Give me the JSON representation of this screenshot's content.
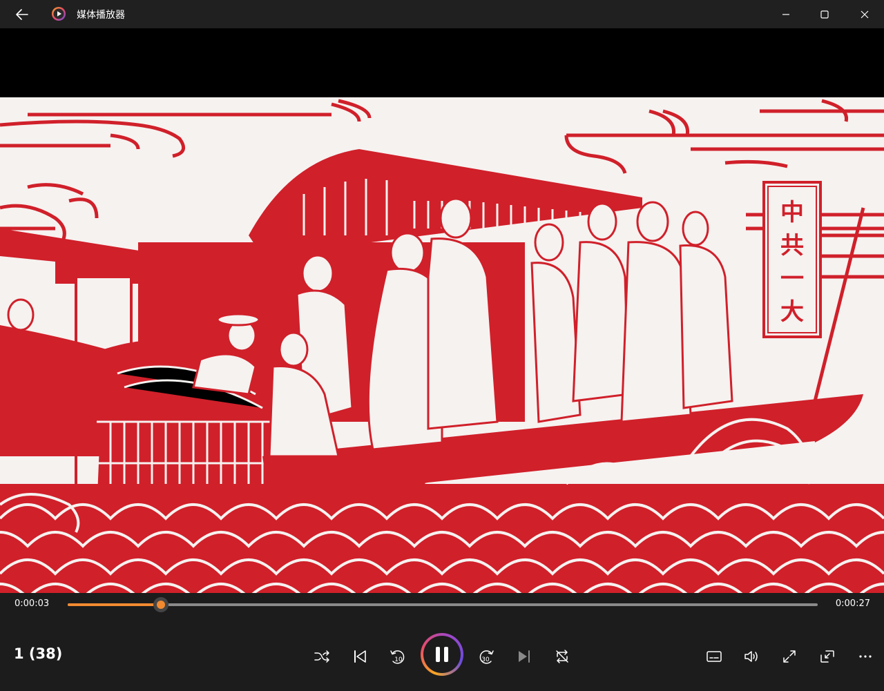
{
  "window": {
    "title": "媒体播放器",
    "accent": "#f28a30"
  },
  "icons": {
    "back": "back-arrow-icon",
    "app": "media-player-app-icon",
    "minimize": "minimize-icon",
    "maximize": "maximize-icon",
    "close": "close-icon",
    "shuffle": "shuffle-icon",
    "previous": "previous-track-icon",
    "rewind": "skip-back-10-icon",
    "pause": "pause-icon",
    "forward": "skip-forward-30-icon",
    "next": "next-track-icon",
    "repeat": "repeat-icon",
    "subtitles": "subtitles-icon",
    "volume": "volume-icon",
    "fullscreen": "fullscreen-icon",
    "miniplayer": "mini-player-icon",
    "more": "more-options-icon"
  },
  "video": {
    "banner_text": [
      "中",
      "共",
      "一",
      "大"
    ],
    "art_color": "#d0202a"
  },
  "playback": {
    "current_time": "0:00:03",
    "duration": "0:00:27",
    "progress": 0.124,
    "media_name": "1 (38)",
    "skip_back_seconds": "10",
    "skip_forward_seconds": "30"
  }
}
